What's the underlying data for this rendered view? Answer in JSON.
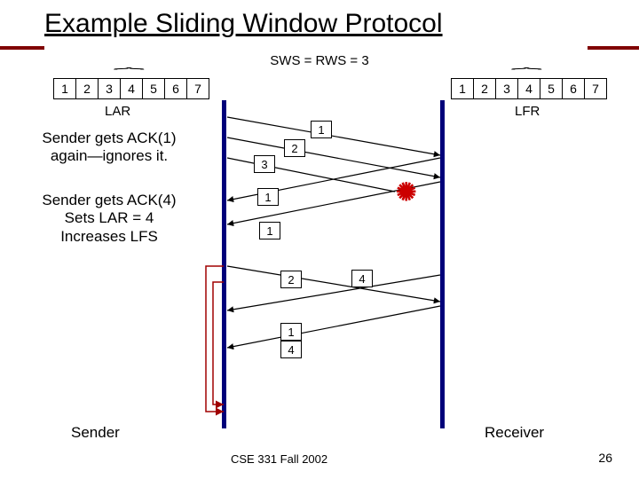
{
  "title": "Example Sliding Window Protocol",
  "subtitle": "SWS = RWS = 3",
  "sender_cells": [
    "1",
    "2",
    "3",
    "4",
    "5",
    "6",
    "7"
  ],
  "receiver_cells": [
    "1",
    "2",
    "3",
    "4",
    "5",
    "6",
    "7"
  ],
  "label_lar": "LAR",
  "label_lfr": "LFR",
  "note1_line1": "Sender gets ACK(1)",
  "note1_line2": "again—ignores it.",
  "note2_line1": "Sender gets ACK(4)",
  "note2_line2": "Sets LAR = 4",
  "note2_line3": "Increases LFS",
  "packets": {
    "p1": "1",
    "p2": "2",
    "p3": "3",
    "p1a": "1",
    "p1b": "1",
    "p2a": "2",
    "p4": "4",
    "p1c": "1",
    "p4b": "4"
  },
  "sender_label": "Sender",
  "receiver_label": "Receiver",
  "footer": "CSE 331 Fall 2002",
  "page": "26"
}
